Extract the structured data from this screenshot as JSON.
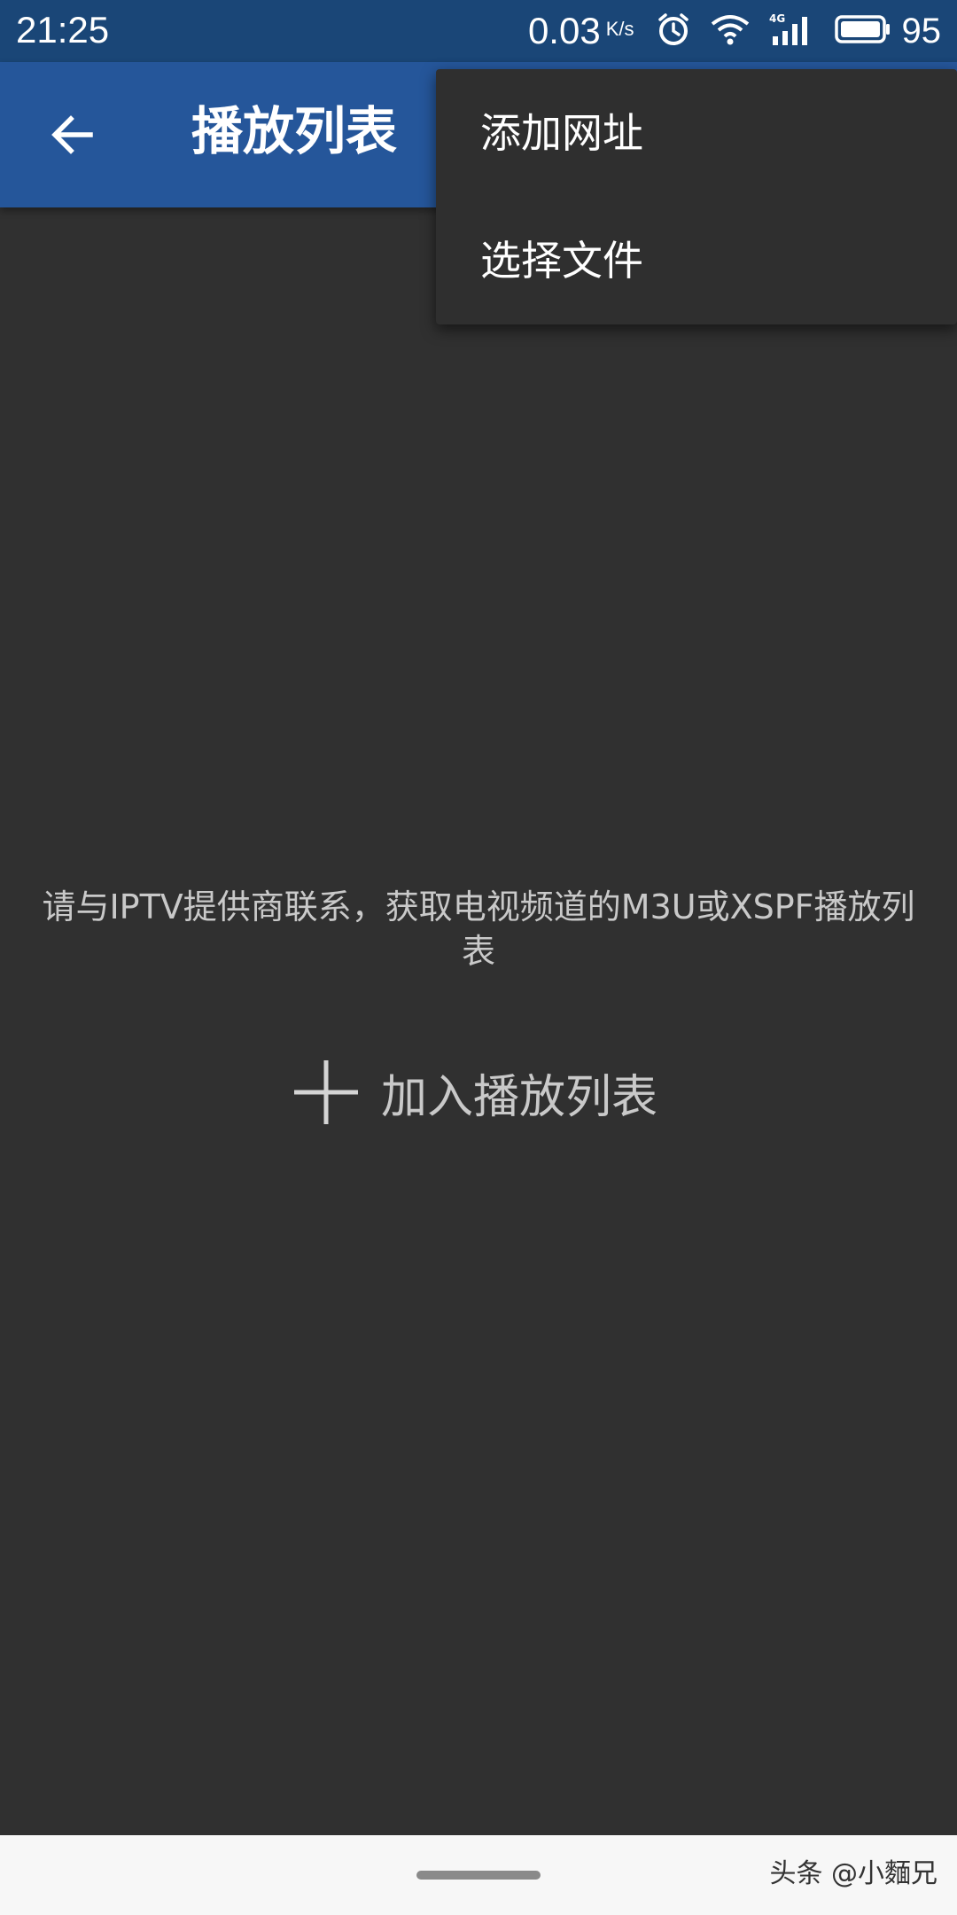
{
  "status_bar": {
    "time": "21:25",
    "net_speed": "0.03",
    "net_unit": "K/s",
    "network_label": "4G",
    "battery": "95",
    "icons": [
      "alarm-icon",
      "wifi-icon",
      "signal-4g-icon",
      "battery-icon"
    ]
  },
  "app_bar": {
    "title": "播放列表",
    "back_icon": "arrow-left-icon"
  },
  "menu": {
    "items": [
      {
        "label": "添加网址"
      },
      {
        "label": "选择文件"
      }
    ]
  },
  "main": {
    "empty_message": "请与IPTV提供商联系，获取电视频道的M3U或XSPF播放列表",
    "add_button": {
      "icon": "plus-icon",
      "label": "加入播放列表"
    }
  },
  "watermark": "头条 @小麵兄",
  "colors": {
    "status_bar": "#1a4677",
    "app_bar": "#25569a",
    "background": "#303030",
    "menu": "#2f2f2f",
    "nav_bar": "#f7f7f7"
  }
}
